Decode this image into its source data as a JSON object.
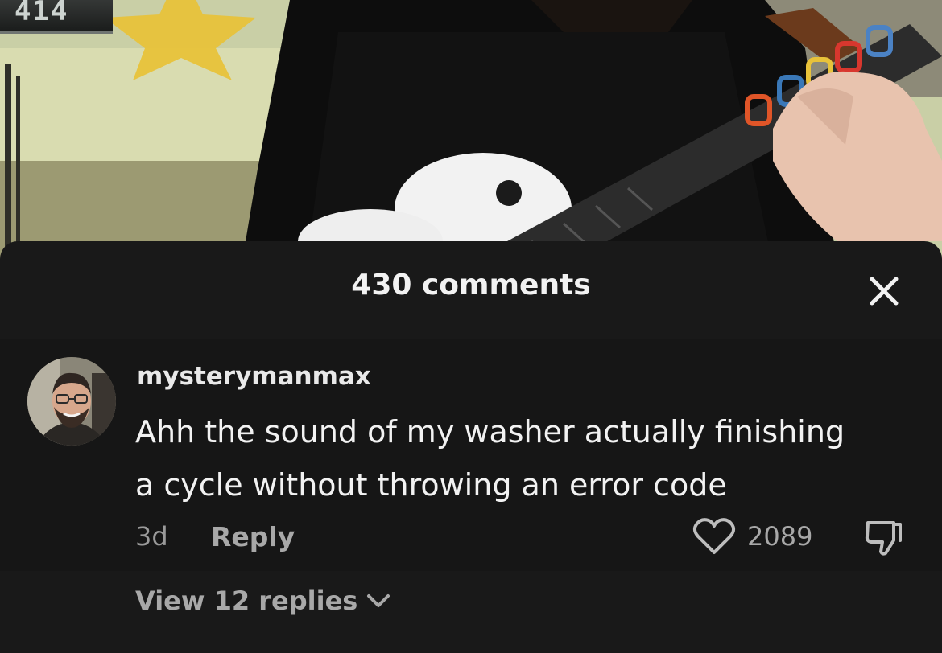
{
  "video": {
    "score_badge": "414"
  },
  "comments_sheet": {
    "title": "430 comments",
    "close_icon": "close-icon"
  },
  "comment": {
    "avatar_icon": "avatar",
    "username": "mysterymanmax",
    "text_lines": [
      "Ahh the sound of my washer actually finishing",
      "a cycle without throwing an error code"
    ],
    "age": "3d",
    "reply_label": "Reply",
    "like_icon": "heart-icon",
    "like_count": "2089",
    "dislike_icon": "thumbs-down-icon",
    "view_replies_label": "View 12 replies",
    "view_replies_icon": "chevron-down-icon"
  }
}
